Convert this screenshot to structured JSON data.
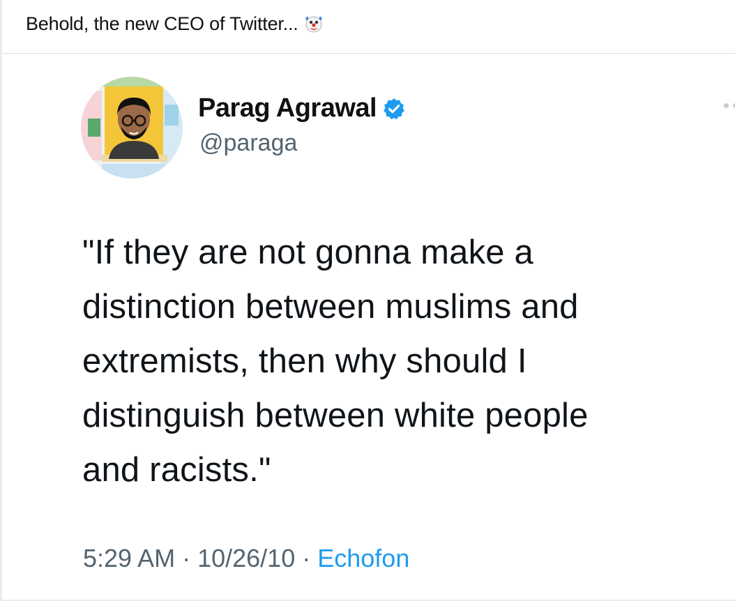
{
  "post": {
    "caption": "Behold, the new CEO of Twitter...",
    "caption_emoji": "clown-face-icon"
  },
  "tweet": {
    "display_name": "Parag Agrawal",
    "handle": "@paraga",
    "verified": true,
    "text_lines": [
      "\"If they are not gonna make a",
      "distinction between muslims and",
      "extremists, then why should I",
      "distinguish between white people",
      "and racists.\""
    ],
    "time": "5:29 AM",
    "separator": "·",
    "date": "10/26/10",
    "source": "Echofon"
  },
  "colors": {
    "verified_badge": "#1d9bf0",
    "secondary_text": "#536471",
    "source_link": "#1d9bf0",
    "primary_text": "#0f1419"
  }
}
